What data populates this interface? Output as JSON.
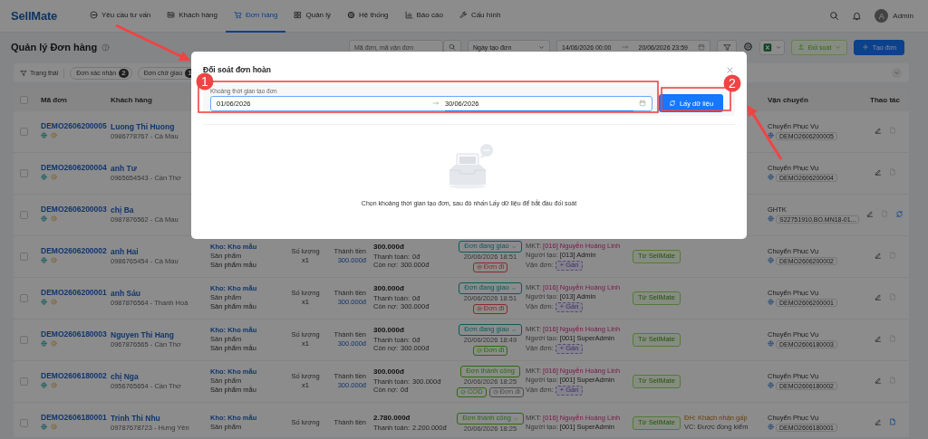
{
  "nav": {
    "logo": "SellMate",
    "items": [
      {
        "label": "Yêu cầu tư vấn",
        "selected": false
      },
      {
        "label": "Khách hàng",
        "selected": false
      },
      {
        "label": "Đơn hàng",
        "selected": true
      },
      {
        "label": "Quản lý",
        "selected": false
      },
      {
        "label": "Hệ thống",
        "selected": false
      },
      {
        "label": "Báo cáo",
        "selected": false
      },
      {
        "label": "Cấu hình",
        "selected": false
      }
    ],
    "user": {
      "avatar": "A",
      "name": "Admin"
    }
  },
  "header": {
    "title": "Quản lý Đơn hàng",
    "search_placeholder": "Mã đơn, mã vận đơn",
    "date_field": "Ngày tạo đơn",
    "date_from": "14/06/2026 00:00",
    "date_to": "20/06/2026 23:59",
    "reconcile_button": "Đối soát",
    "create_button": "Tạo đơn"
  },
  "filters": {
    "status_label": "Trạng thái",
    "chips": [
      {
        "label": "Đơn xác nhận",
        "count": "2"
      },
      {
        "label": "Đơn chờ giao",
        "count": "1"
      }
    ]
  },
  "table": {
    "select_all_checked": false,
    "columns": {
      "code": "Mã đơn",
      "customer": "Khách hàng",
      "shipping": "Vận chuyển",
      "actions": "Thao tác"
    },
    "rows": [
      {
        "checked": false,
        "code": "DEMO2606200005",
        "customer": "Luong Thi Huong",
        "phone": "0986778767 - Cà Mau",
        "carrier": "Chuyển Phục Vụ",
        "tracking": "DEMO2606200005",
        "document_active": false,
        "sync": false
      },
      {
        "checked": false,
        "code": "DEMO2606200004",
        "customer": "anh Tư",
        "phone": "0965654543 - Cần Thơ",
        "carrier": "Chuyển Phục Vụ",
        "tracking": "DEMO2606200004",
        "document_active": false,
        "sync": false
      },
      {
        "checked": false,
        "code": "DEMO2606200003",
        "customer": "chị Ba",
        "phone": "0987876562 - Cà Mau",
        "carrier": "GHTK",
        "tracking": "S22751910.BO.MN18-01...",
        "document_active": false,
        "sync": true
      },
      {
        "checked": false,
        "code": "DEMO2606200002",
        "customer": "anh Hai",
        "phone": "0986765454 - Cà Mau",
        "warehouse": "Kho: Kho mẫu",
        "product_label": "Sản phẩm",
        "product": "Sản phẩm mẫu",
        "qty_label": "Số lượng",
        "qty": "x1",
        "total_label": "Thành tiền",
        "total": "300.000đ",
        "amount": "300.000đ",
        "paid_label": "Thanh toán:",
        "paid": "0đ",
        "debt_label": "Còn nợ:",
        "debt": "300.000đ",
        "status": {
          "label": "Đơn đang giao",
          "dropdown": true,
          "color": "#0a5c5c"
        },
        "status_time": "20/06/2026 18:51",
        "tags": [
          {
            "label": "Đơn đi",
            "kind": "cancelled",
            "color": "#8c2a2b"
          }
        ],
        "mkt_label": "MKT:",
        "mkt": "[016] Nguyễn Hoàng Linh",
        "creator_label": "Người tạo:",
        "creator": "[013] Admin",
        "waybill_label": "Vận đơn:",
        "assign": "+ Gán",
        "source": "Từ SellMate",
        "carrier": "Chuyển Phục Vụ",
        "tracking": "DEMO2606200002",
        "document_active": false,
        "sync": false
      },
      {
        "checked": false,
        "code": "DEMO2606200001",
        "customer": "anh Sáu",
        "phone": "0987876564 - Thanh Hoá",
        "warehouse": "Kho: Kho mẫu",
        "product_label": "Sản phẩm",
        "product": "Sản phẩm mẫu",
        "qty_label": "Số lượng",
        "qty": "x1",
        "total_label": "Thành tiền",
        "total": "300.000đ",
        "amount": "300.000đ",
        "paid_label": "Thanh toán:",
        "paid": "0đ",
        "debt_label": "Còn nợ:",
        "debt": "300.000đ",
        "status": {
          "label": "Đơn đang giao",
          "dropdown": true,
          "color": "#0a5c5c"
        },
        "status_time": "20/06/2026 18:51",
        "tags": [
          {
            "label": "Đơn đi",
            "kind": "cancelled",
            "color": "#8c2a2b"
          }
        ],
        "mkt_label": "MKT:",
        "mkt": "[016] Nguyễn Hoàng Linh",
        "creator_label": "Người tạo:",
        "creator": "[013] Admin",
        "waybill_label": "Vận đơn:",
        "assign": "+ Gán",
        "source": "Từ SellMate",
        "carrier": "Chuyển Phục Vụ",
        "tracking": "DEMO2606200001",
        "document_active": false,
        "sync": false
      },
      {
        "checked": false,
        "code": "DEMO2606180003",
        "customer": "Nguyen Thi Hang",
        "phone": "0967876565 - Cần Thơ",
        "warehouse": "Kho: Kho mẫu",
        "product_label": "Sản phẩm",
        "product": "Sản phẩm mẫu",
        "qty_label": "Số lượng",
        "qty": "x1",
        "total_label": "Thành tiền",
        "total": "300.000đ",
        "amount": "300.000đ",
        "paid_label": "Thanh toán:",
        "paid": "0đ",
        "debt_label": "Còn nợ:",
        "debt": "300.000đ",
        "status": {
          "label": "Đơn đang giao",
          "dropdown": true,
          "color": "#0a5c5c"
        },
        "status_time": "20/06/2026 18:49",
        "tags": [
          {
            "label": "Đơn đi",
            "kind": "done",
            "color": "#2d6c0e"
          }
        ],
        "mkt_label": "MKT:",
        "mkt": "[016] Nguyễn Hoàng Linh",
        "creator_label": "Người tạo:",
        "creator": "[001] SuperAdmin",
        "waybill_label": "Vận đơn:",
        "assign": "+ Gán",
        "source": "Từ SellMate",
        "carrier": "Chuyển Phục Vụ",
        "tracking": "DEMO2606180003",
        "document_active": false,
        "sync": false
      },
      {
        "checked": false,
        "code": "DEMO2606180002",
        "customer": "chị Nga",
        "phone": "0956765654 - Cần Thơ",
        "warehouse": "Kho: Kho mẫu",
        "product_label": "Sản phẩm",
        "product": "Sản phẩm mẫu",
        "qty_label": "Số lượng",
        "qty": "x1",
        "total_label": "Thành tiền",
        "total": "300.000đ",
        "amount": "300.000đ",
        "paid_label": "Thanh toán:",
        "paid": "300.000đ",
        "debt_label": "Còn nợ:",
        "debt": "0đ",
        "status": {
          "label": "Đơn thành công",
          "dropdown": false,
          "color": "#2d6c0e"
        },
        "status_time": "20/06/2026 18:25",
        "tags": [
          {
            "label": "COD",
            "kind": "done",
            "color": "#2d6c0e"
          },
          {
            "label": "Đơn đi",
            "kind": "pending",
            "color": "#4d4d4d"
          }
        ],
        "mkt_label": "MKT:",
        "mkt": "[016] Nguyễn Hoàng Linh",
        "creator_label": "Người tạo:",
        "creator": "[001] SuperAdmin",
        "waybill_label": "Vận đơn:",
        "assign": "+ Gán",
        "source": "Từ SellMate",
        "carrier": "Chuyển Phục Vụ",
        "tracking": "DEMO2606180002",
        "document_active": false,
        "sync": false
      },
      {
        "checked": false,
        "code": "DEMO2606180001",
        "customer": "Trinh Thi Nhu",
        "phone": "09787678723 - Hưng Yên",
        "warehouse": "Kho: Kho mẫu",
        "product_label": "Sản phẩm",
        "qty_label": "Số lượng",
        "total_label": "Thành tiền",
        "amount": "2.780.000đ",
        "paid_label": "Thanh toán:",
        "paid": "2.200.000đ",
        "status": {
          "label": "Đơn thành công",
          "dropdown": true,
          "color": "#2d6c0e"
        },
        "status_time": "20/06/2026 18:25",
        "mkt_label": "MKT:",
        "mkt": "[016] Nguyễn Hoàng Linh",
        "creator_label": "Người tạo:",
        "creator": "[001] SuperAdmin",
        "source": "Từ SellMate",
        "note_order": "ĐH: Khách nhận gấp",
        "note_ship": "VC: Được đồng kiểm",
        "carrier": "Chuyển Phục Vụ",
        "tracking": "DEMO2606180001",
        "document_active": true,
        "sync": false
      }
    ]
  },
  "modal": {
    "title": "Đối soát đơn hoàn",
    "range_label": "Khoảng thời gian tạo đơn",
    "start": "01/06/2026",
    "end": "30/06/2026",
    "fetch_button": "Lấy dữ liệu",
    "empty_text": "Chọn khoảng thời gian tạo đơn, sau đó nhấn Lấy dữ liệu để bắt đầu đối soát"
  },
  "guide": {
    "markers": [
      {
        "label": "1"
      },
      {
        "label": "2"
      }
    ]
  }
}
